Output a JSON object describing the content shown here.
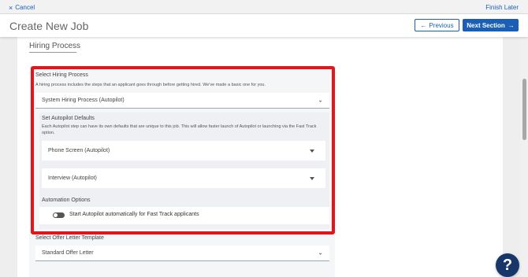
{
  "topbar": {
    "cancel_label": "Cancel",
    "finish_later_label": "Finish Later"
  },
  "header": {
    "title": "Create New Job",
    "previous_label": "Previous",
    "next_label": "Next Section"
  },
  "section": {
    "title": "Hiring Process"
  },
  "hiring_process": {
    "label": "Select Hiring Process",
    "description": "A hiring process includes the steps that an applicant goes through before getting hired. We've made a basic one for you.",
    "selected": "System Hiring Process (Autopilot)"
  },
  "autopilot": {
    "label": "Set Autopilot Defaults",
    "description": "Each Autopilot step can have its own defaults that are unique to this job. This will allow faster launch of Autopilot or launching via the Fast Track option.",
    "steps": [
      "Phone Screen (Autopilot)",
      "Interview (Autopilot)"
    ]
  },
  "automation": {
    "label": "Automation Options",
    "toggle_label": "Start Autopilot automatically for Fast Track applicants",
    "toggle_on": false
  },
  "offer_letter": {
    "label": "Select Offer Letter Template",
    "selected": "Standard Offer Letter"
  },
  "help": {
    "label": "?"
  },
  "colors": {
    "accent": "#1a5fb4",
    "highlight": "#e4141b",
    "help": "#17376b"
  },
  "icons": [
    "close-icon",
    "arrow-left-icon",
    "arrow-right-icon",
    "chevron-down-icon",
    "caret-down-icon",
    "help-icon"
  ]
}
